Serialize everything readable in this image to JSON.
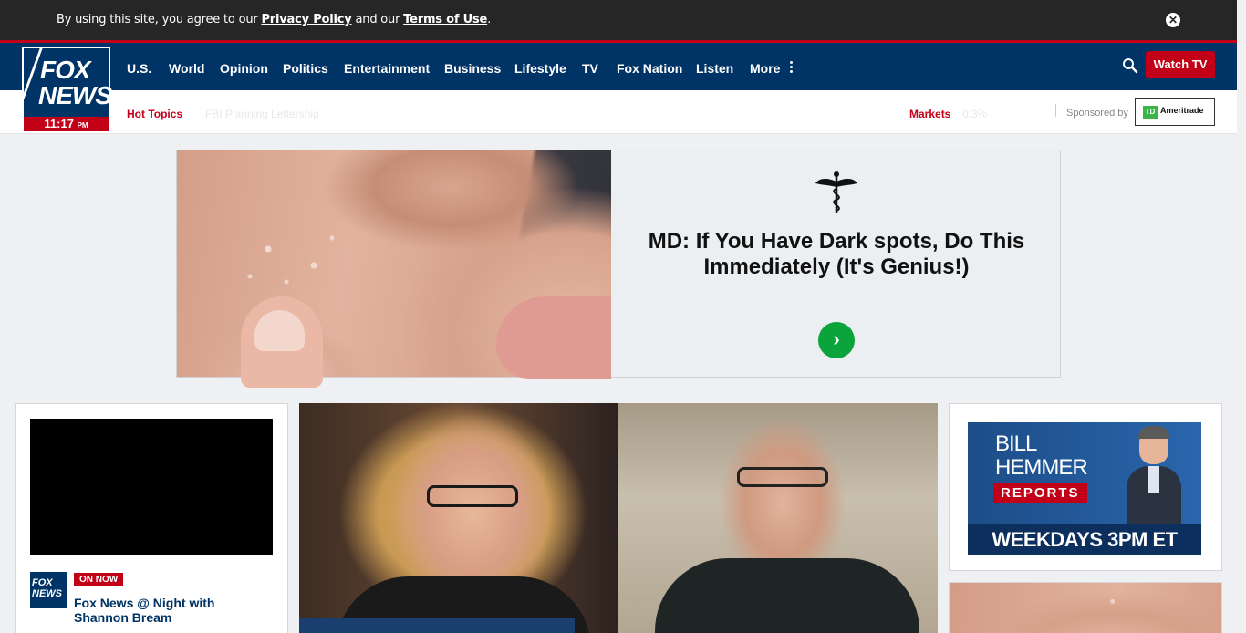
{
  "cookie_bar": {
    "prefix": "By using this site, you agree to our ",
    "privacy_link": "Privacy Policy",
    "middle": " and our ",
    "terms_link": "Terms of Use",
    "suffix": ".",
    "close_symbol": "✕"
  },
  "logo": {
    "line1": "FOX",
    "line2": "NEWS",
    "time": "11:17",
    "meridiem": "PM"
  },
  "nav": {
    "items": [
      "U.S.",
      "World",
      "Opinion",
      "Politics",
      "Entertainment",
      "Business",
      "Lifestyle",
      "TV",
      "Fox Nation",
      "Listen",
      "More"
    ],
    "watch_tv": "Watch TV",
    "icons": [
      "search-icon",
      "more-dots-icon"
    ]
  },
  "subnav": {
    "hot_topics_label": "Hot Topics",
    "hot_topics_faded": "FBI Planning Lettership",
    "markets_label": "Markets",
    "markets_faded": "0.3%",
    "sponsored_by": "Sponsored by",
    "sponsor_name": "Ameritrade",
    "sponsor_mark": "TD"
  },
  "ad": {
    "headline": "MD: If You Have Dark spots, Do This Immediately (It's Genius!)",
    "cta_symbol": "›",
    "colors": {
      "cta": "#0aa43a"
    }
  },
  "video": {
    "badge": "ON NOW",
    "show_title": "Fox News @ Night with Shannon Bream",
    "mini_logo_line1": "FOX",
    "mini_logo_line2": "NEWS"
  },
  "promo": {
    "line1": "BILL",
    "line2": "HEMMER",
    "line3": "REPORTS",
    "schedule": "WEEKDAYS 3PM ET"
  },
  "colors": {
    "brand_blue": "#003366",
    "brand_red": "#c20017",
    "cookie_bg": "#262626"
  }
}
